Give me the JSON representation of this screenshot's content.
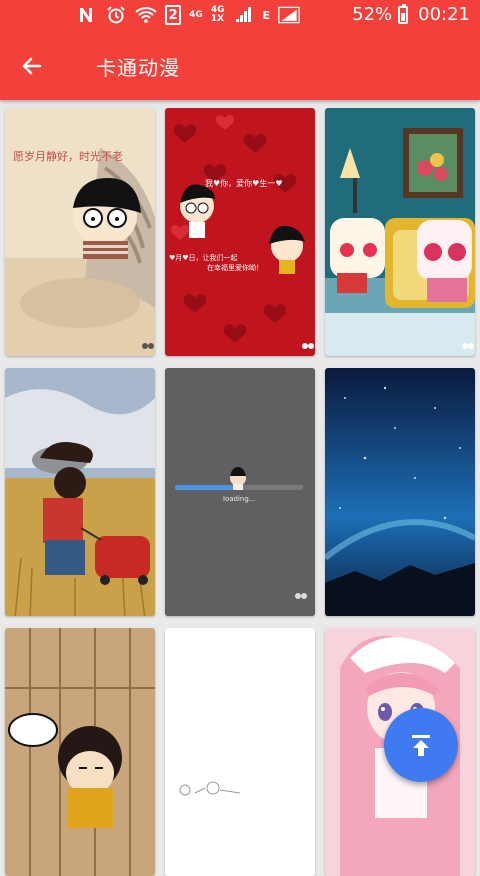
{
  "status_bar": {
    "battery": "52%",
    "time": "00:21",
    "sim_badge": "2",
    "network_4g_a": "4G",
    "network_4g_b": "4G",
    "network_1x": "1X",
    "network_e": "E",
    "battery_level": 0.52
  },
  "app_bar": {
    "title": "卡通动漫",
    "back_icon": "arrow-left-icon"
  },
  "grid": {
    "tiles": [
      {
        "caption": "愿岁月静好，时光不老"
      },
      {
        "caption_a": "我♥你，爱你♥生一♥",
        "caption_b": "♥月♥日，让我们一起",
        "caption_c": "在幸福里爱你呦！"
      },
      {},
      {},
      {
        "loading_text": "loading..."
      },
      {},
      {},
      {},
      {}
    ]
  },
  "fab": {
    "icon": "scroll-to-top-icon"
  }
}
